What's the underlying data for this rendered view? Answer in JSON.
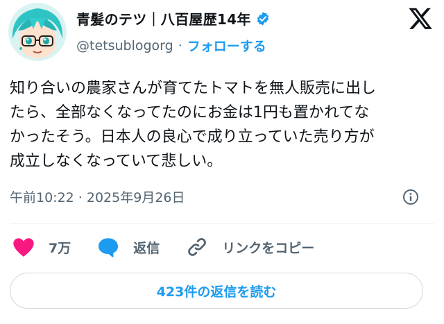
{
  "author": {
    "display_name": "青髪のテツ｜八百屋歴14年",
    "handle": "@tetsublogorg",
    "separator": "·",
    "follow_label": "フォローする",
    "avatar_icon": "anime-avatar-teal-hair",
    "verified_icon": "verified-badge-icon"
  },
  "platform": {
    "logo_icon": "x-logo-icon"
  },
  "tweet": {
    "text": "知り合いの農家さんが育てたトマトを無人販売に出し\nたら、全部なくなってたのにお金は1円も置かれてな\nかったそう。日本人の良心で成り立っていた売り方が\n成立しなくなっていて悲しい。",
    "timestamp": "午前10:22 · 2025年9月26日",
    "info_icon": "info-icon"
  },
  "actions": {
    "like": {
      "icon": "heart-icon",
      "count": "7万"
    },
    "reply": {
      "icon": "reply-bubble-icon",
      "label": "返信"
    },
    "copy_link": {
      "icon": "link-icon",
      "label": "リンクをコピー"
    }
  },
  "replies_button": {
    "label": "423件の返信を読む"
  },
  "colors": {
    "accent": "#1d9bf0",
    "like": "#f91880",
    "text": "#0f1419",
    "muted": "#536471",
    "border": "#cfd9de"
  }
}
